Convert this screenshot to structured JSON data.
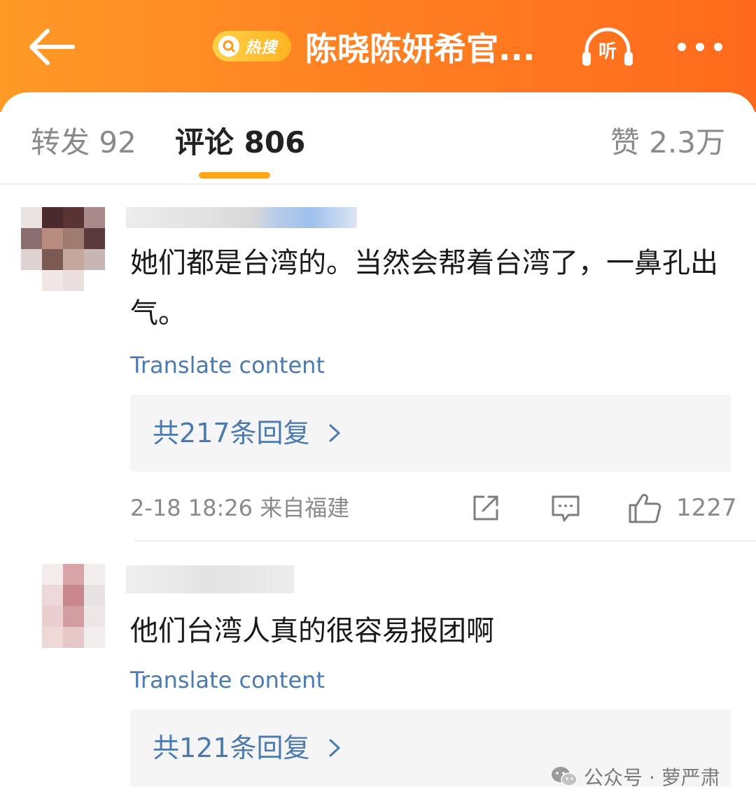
{
  "colors": {
    "header_gradient_start": "#ff9a26",
    "header_gradient_end": "#ff6a1c",
    "tab_indicator": "#ffa51a",
    "link_blue": "#4a7ab0",
    "muted_gray": "#8a8a8a"
  },
  "header": {
    "back_icon": "arrow-left-icon",
    "hot_badge_label": "热搜",
    "title": "陈晓陈妍希官...",
    "listen_label": "听",
    "more_icon": "more-dots-icon"
  },
  "tabs": {
    "reposts": "转发 92",
    "comments": "评论 806",
    "likes": "赞 2.3万"
  },
  "comments": [
    {
      "text": "她们都是台湾的。当然会帮着台湾了，一鼻孔出气。",
      "translate": "Translate content",
      "replies": "共217条回复",
      "time_location": "2-18 18:26  来自福建",
      "like_count": "1227"
    },
    {
      "text": "他们台湾人真的很容易报团啊",
      "translate": "Translate content",
      "replies": "共121条回复"
    }
  ],
  "watermark": {
    "text": "公众号 · 萝严肃",
    "icon": "wechat-icon"
  }
}
